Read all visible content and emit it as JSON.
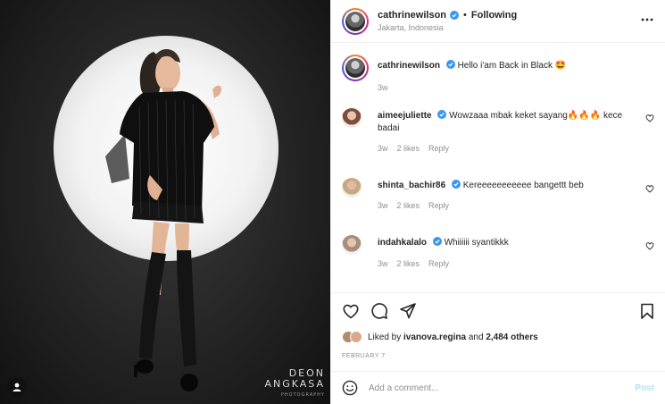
{
  "post": {
    "username": "cathrinewilson",
    "follow_status": "Following",
    "separator": "•",
    "location": "Jakarta, Indonesia",
    "caption": {
      "username": "cathrinewilson",
      "text": "Hello i'am Back in Black 🤩",
      "time": "3w"
    }
  },
  "comments": [
    {
      "username": "aimeejuliette",
      "text": "Wowzaaa mbak keket sayang🔥🔥🔥 kece badai",
      "time": "3w",
      "likes": "2 likes",
      "reply": "Reply"
    },
    {
      "username": "shinta_bachir86",
      "text": "Kereeeeeeeeeee bangettt beb",
      "time": "3w",
      "likes": "2 likes",
      "reply": "Reply"
    },
    {
      "username": "indahkalalo",
      "text": "Whiiiiii syantikkk",
      "time": "3w",
      "likes": "2 likes",
      "reply": "Reply"
    }
  ],
  "likes": {
    "prefix": "Liked by",
    "user": "ivanova.regina",
    "connector": "and",
    "others": "2,484 others"
  },
  "date": "FEBRUARY 7",
  "add_comment": {
    "placeholder": "Add a comment...",
    "post_label": "Post"
  },
  "watermark": {
    "line1": "DEON",
    "line2": "ANGKASA",
    "line3": "PHOTOGRAPHY"
  },
  "colors": {
    "verified": "#3897f0",
    "post_button_disabled": "#b2dffc"
  }
}
